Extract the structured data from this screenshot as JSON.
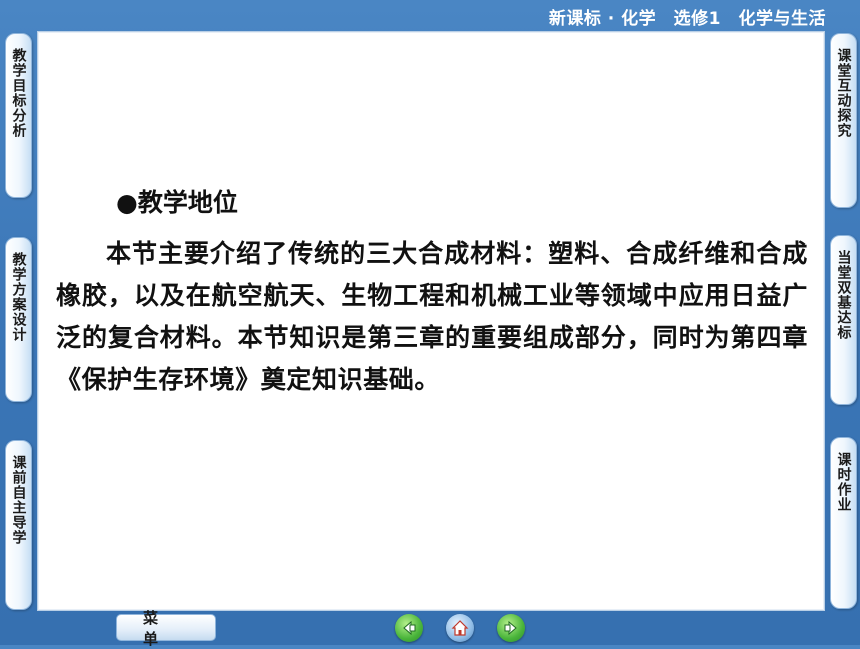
{
  "header": {
    "title": "新课标 · 化学　选修1　化学与生活"
  },
  "left_tabs": [
    {
      "label": "教学目标分析"
    },
    {
      "label": "教学方案设计"
    },
    {
      "label": "课前自主导学"
    }
  ],
  "right_tabs": [
    {
      "label": "课堂互动探究"
    },
    {
      "label": "当堂双基达标"
    },
    {
      "label": "课时作业"
    }
  ],
  "content": {
    "heading": "●教学地位",
    "paragraph": "本节主要介绍了传统的三大合成材料：塑料、合成纤维和合成橡胶，以及在航空航天、生物工程和机械工业等领域中应用日益广泛的复合材料。本节知识是第三章的重要组成部分，同时为第四章《保护生存环境》奠定知识基础。"
  },
  "footer": {
    "menu_label": "菜单",
    "nav_icons": [
      "previous-icon",
      "home-icon",
      "next-icon"
    ]
  },
  "colors": {
    "background": "#3a75b6",
    "panel": "#ffffff",
    "tab_border": "#8fb5dc"
  }
}
